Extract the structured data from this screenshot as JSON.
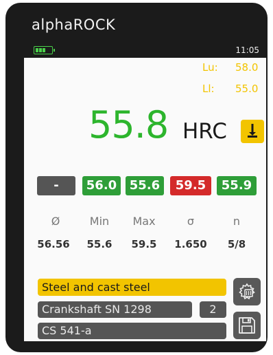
{
  "device": {
    "brand": "alphaROCK"
  },
  "status": {
    "battery_icon": "battery-icon",
    "time": "11:05"
  },
  "limits": {
    "upper": {
      "label": "Lu:",
      "value": "58.0"
    },
    "lower": {
      "label": "Ll:",
      "value": "55.0"
    }
  },
  "reading": {
    "value": "55.8",
    "unit": "HRC",
    "trend_icon": "arrow-down-icon"
  },
  "measurements": [
    {
      "text": "-",
      "status": "neutral",
      "color": "#555555"
    },
    {
      "text": "56.0",
      "status": "ok",
      "color": "#2e9e38"
    },
    {
      "text": "55.6",
      "status": "ok",
      "color": "#2e9e38"
    },
    {
      "text": "59.5",
      "status": "out-of-range",
      "color": "#d42a2a"
    },
    {
      "text": "55.9",
      "status": "ok",
      "color": "#2e9e38"
    }
  ],
  "statistics": {
    "headers": [
      "Ø",
      "Min",
      "Max",
      "σ",
      "n"
    ],
    "values": [
      "56.56",
      "55.6",
      "59.5",
      "1.650",
      "5/8"
    ]
  },
  "material": "Steel and cast steel",
  "sample": {
    "name": "Crankshaft SN 1298",
    "count": "2"
  },
  "probe": "CS 541-a",
  "buttons": {
    "settings_icon": "settings-gear-icon",
    "save_icon": "floppy-disk-icon"
  },
  "colors": {
    "accent": "#f2c400",
    "ok": "#2e9e38",
    "fail": "#d42a2a",
    "reading": "#2db52d"
  }
}
